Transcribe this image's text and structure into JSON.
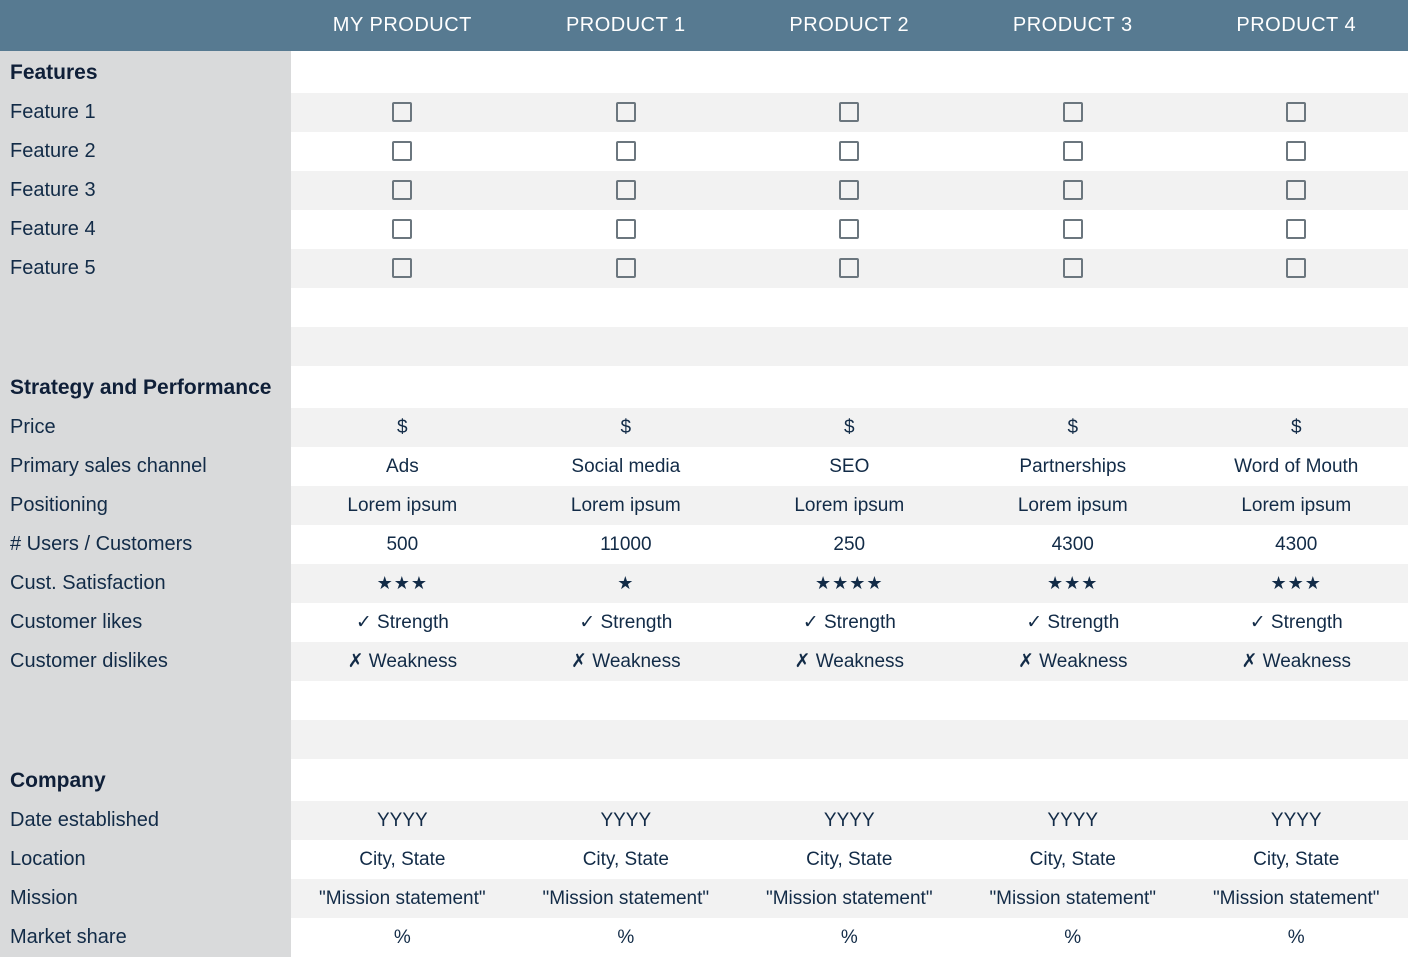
{
  "columns": [
    "MY PRODUCT",
    "PRODUCT 1",
    "PRODUCT 2",
    "PRODUCT 3",
    "PRODUCT 4"
  ],
  "sections": {
    "features": {
      "title": "Features",
      "rows": [
        {
          "label": "Feature 1",
          "type": "check",
          "v": [
            false,
            false,
            false,
            false,
            false
          ]
        },
        {
          "label": "Feature 2",
          "type": "check",
          "v": [
            false,
            false,
            false,
            false,
            false
          ]
        },
        {
          "label": "Feature 3",
          "type": "check",
          "v": [
            false,
            false,
            false,
            false,
            false
          ]
        },
        {
          "label": "Feature 4",
          "type": "check",
          "v": [
            false,
            false,
            false,
            false,
            false
          ]
        },
        {
          "label": "Feature 5",
          "type": "check",
          "v": [
            false,
            false,
            false,
            false,
            false
          ]
        }
      ]
    },
    "strategy": {
      "title": "Strategy and Performance",
      "rows": [
        {
          "label": "Price",
          "type": "text",
          "v": [
            "$",
            "$",
            "$",
            "$",
            "$"
          ]
        },
        {
          "label": "Primary sales channel",
          "type": "text",
          "v": [
            "Ads",
            "Social media",
            "SEO",
            "Partnerships",
            "Word of Mouth"
          ]
        },
        {
          "label": "Positioning",
          "type": "text",
          "v": [
            "Lorem ipsum",
            "Lorem ipsum",
            "Lorem ipsum",
            "Lorem ipsum",
            "Lorem ipsum"
          ]
        },
        {
          "label": "# Users / Customers",
          "type": "text",
          "v": [
            "500",
            "11000",
            "250",
            "4300",
            "4300"
          ]
        },
        {
          "label": "Cust. Satisfaction",
          "type": "stars",
          "v": [
            3,
            1,
            4,
            3,
            3
          ]
        },
        {
          "label": "Customer likes",
          "type": "text",
          "v": [
            "✓ Strength",
            "✓ Strength",
            "✓ Strength",
            "✓ Strength",
            "✓ Strength"
          ]
        },
        {
          "label": "Customer dislikes",
          "type": "text",
          "v": [
            "✗ Weakness",
            "✗ Weakness",
            "✗ Weakness",
            "✗ Weakness",
            "✗ Weakness"
          ]
        }
      ]
    },
    "company": {
      "title": "Company",
      "rows": [
        {
          "label": "Date established",
          "type": "text",
          "v": [
            "YYYY",
            "YYYY",
            "YYYY",
            "YYYY",
            "YYYY"
          ]
        },
        {
          "label": "Location",
          "type": "text",
          "v": [
            "City, State",
            "City, State",
            "City, State",
            "City, State",
            "City, State"
          ]
        },
        {
          "label": "Mission",
          "type": "text",
          "v": [
            "\"Mission statement\"",
            "\"Mission statement\"",
            "\"Mission statement\"",
            "\"Mission statement\"",
            "\"Mission statement\""
          ]
        },
        {
          "label": "Market share",
          "type": "text",
          "v": [
            "%",
            "%",
            "%",
            "%",
            "%"
          ]
        }
      ]
    }
  }
}
